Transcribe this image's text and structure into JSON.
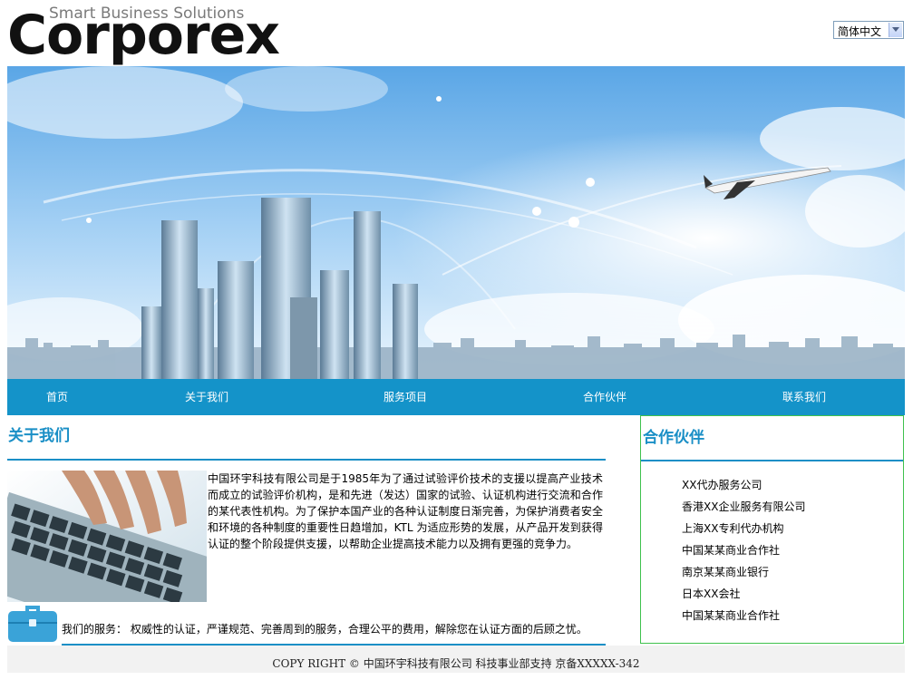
{
  "header": {
    "logo_main": "Corporex",
    "logo_tagline": "Smart Business Solutions",
    "language": {
      "selected": "简体中文"
    }
  },
  "nav": {
    "items": [
      "首页",
      "关于我们",
      "服务项目",
      "合作伙伴",
      "联系我们"
    ]
  },
  "about": {
    "title": "关于我们",
    "text": "中国环宇科技有限公司是于1985年为了通过试验评价技术的支援以提高产业技术而成立的试验评价机构，是和先进（发达）国家的试验、认证机构进行交流和合作的某代表性机构。为了保护本国产业的各种认证制度日渐完善，为保护消费者安全和环境的各种制度的重要性日趋增加，KTL 为适应形势的发展，从产品开发到获得认证的整个阶段提供支援，以帮助企业提高技术能力以及拥有更强的竞争力。",
    "service": "我们的服务：  权威性的认证，严谨规范、完善周到的服务，合理公平的费用，解除您在认证方面的后顾之忧。"
  },
  "partners": {
    "title": "合作伙伴",
    "items": [
      "XX代办服务公司",
      "香港XX企业服务有限公司",
      "上海XX专利代办机构",
      "中国某某商业合作社",
      "南京某某商业银行",
      "日本XX会社",
      "中国某某商业合作社"
    ]
  },
  "footer": {
    "text": "COPY RIGHT ©   中国环宇科技有限公司   科技事业部支持 京备XXXXX-342"
  },
  "colors": {
    "accent": "#1a8fc6",
    "nav_bg": "#1493c9",
    "partner_border": "#3fc14d",
    "footer_bg": "#f2f2f2"
  },
  "icons": {
    "language_dropdown": "chevron-down-icon",
    "service": "briefcase-icon"
  }
}
